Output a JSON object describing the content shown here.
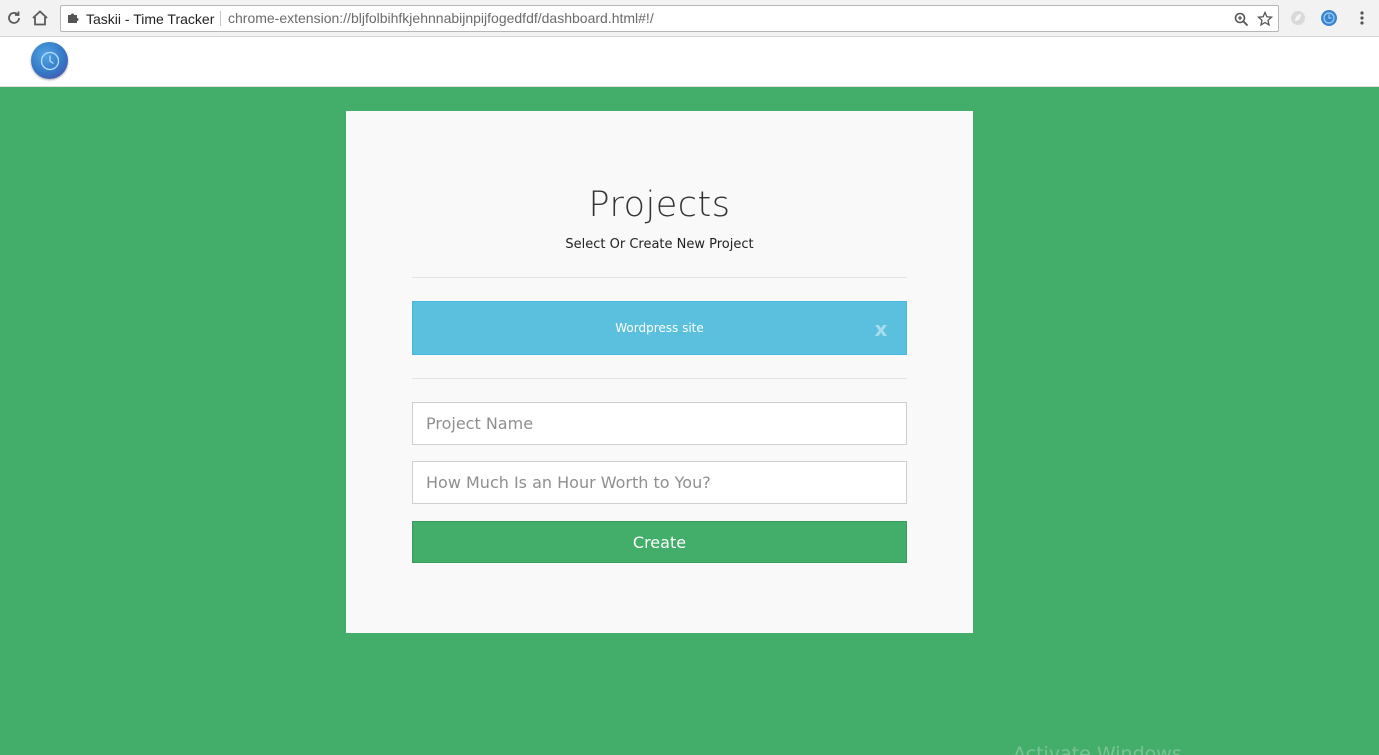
{
  "browser": {
    "tab_title": "Taskii - Time Tracker",
    "url": "chrome-extension://bljfolbihfkjehnnabijnpijfogedfdf/dashboard.html#!/",
    "icons": {
      "reload": "reload-icon",
      "home": "home-icon",
      "extension": "puzzle-piece-icon",
      "zoom": "zoom-icon",
      "bookmark": "star-icon",
      "menu": "kebab-menu-icon"
    }
  },
  "app": {
    "logo": "clock-icon"
  },
  "projects": {
    "title": "Projects",
    "subtitle": "Select Or Create New Project",
    "list": [
      {
        "name": "Wordpress site",
        "delete_label": "x"
      }
    ]
  },
  "form": {
    "project_name_placeholder": "Project Name",
    "hourly_rate_placeholder": "How Much Is an Hour Worth to You?",
    "create_label": "Create"
  },
  "watermark": "Activate Windows",
  "colors": {
    "background": "#43ad6a",
    "project_row": "#5bc0de",
    "create_button": "#43ad6a",
    "card": "#f9f9f9"
  }
}
